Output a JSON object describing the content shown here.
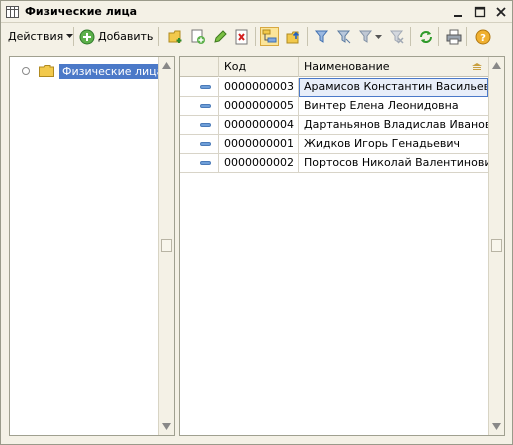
{
  "window": {
    "title": "Физические лица",
    "icon": "list-form-icon",
    "buttons": [
      "minimize-icon",
      "maximize-icon",
      "close-icon"
    ]
  },
  "toolbar": {
    "actions_label": "Действия",
    "add_label": "Добавить",
    "icons": [
      "add-folder-icon",
      "copy-icon",
      "edit-pencil-icon",
      "delete-icon",
      "hierarchy-toggle-icon",
      "parent-folder-icon",
      "filter-icon",
      "filter-by-value-icon",
      "filter-history-icon",
      "clear-filter-icon",
      "refresh-icon",
      "print-icon",
      "help-icon"
    ]
  },
  "tree": {
    "root_label": "Физические лица"
  },
  "grid": {
    "columns": {
      "code": "Код",
      "name": "Наименование"
    },
    "rows": [
      {
        "code": "0000000003",
        "name": "Арамисов Константин Васильевич"
      },
      {
        "code": "0000000005",
        "name": "Винтер Елена Леонидовна"
      },
      {
        "code": "0000000004",
        "name": "Дартаньянов Владислав Иванович"
      },
      {
        "code": "0000000001",
        "name": "Жидков Игорь Генадьевич"
      },
      {
        "code": "0000000002",
        "name": "Портосов Николай Валентинович"
      }
    ],
    "selected_row": 0
  },
  "colors": {
    "window_bg": "#f4f1e6",
    "selection": "#4b79c8",
    "row_icon": "#6f9fd8"
  }
}
